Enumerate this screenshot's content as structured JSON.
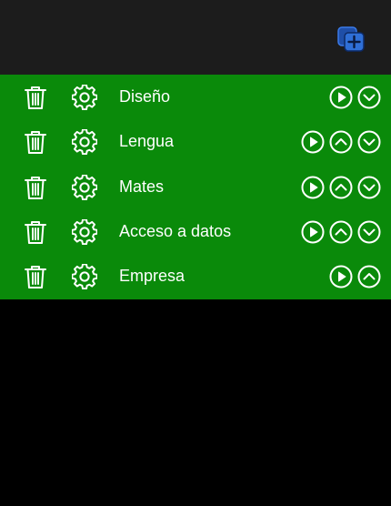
{
  "header": {
    "add_icon": "add-copy-icon",
    "accent_color": "#2f6fd6"
  },
  "list": {
    "background_color": "#0a8a0a",
    "items": [
      {
        "label": "Diseño",
        "controls": [
          "play",
          "down"
        ]
      },
      {
        "label": "Lengua",
        "controls": [
          "play",
          "up",
          "down"
        ]
      },
      {
        "label": "Mates",
        "controls": [
          "play",
          "up",
          "down"
        ]
      },
      {
        "label": "Acceso a datos",
        "controls": [
          "play",
          "up",
          "down"
        ]
      },
      {
        "label": "Empresa",
        "controls": [
          "play",
          "up"
        ]
      }
    ]
  }
}
